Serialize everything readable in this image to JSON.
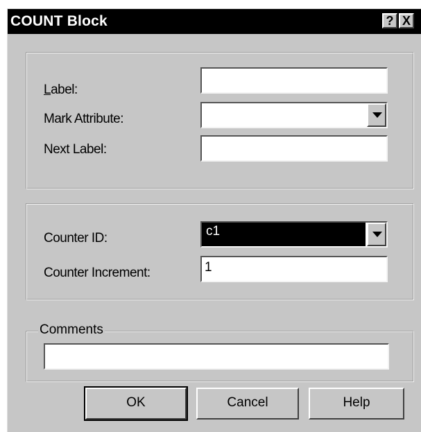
{
  "window": {
    "title": "COUNT Block",
    "help_button": "?",
    "close_button": "X"
  },
  "group1": {
    "label_text": "Label:",
    "label_value": "",
    "mark_attribute_text": "Mark Attribute:",
    "mark_attribute_value": "",
    "next_label_text": "Next Label:",
    "next_label_value": ""
  },
  "group2": {
    "counter_id_text": "Counter ID:",
    "counter_id_value": "c1",
    "counter_increment_text": "Counter Increment:",
    "counter_increment_value": "1"
  },
  "comments": {
    "legend": "Comments",
    "value": ""
  },
  "buttons": {
    "ok": "OK",
    "cancel": "Cancel",
    "help": "Help"
  }
}
